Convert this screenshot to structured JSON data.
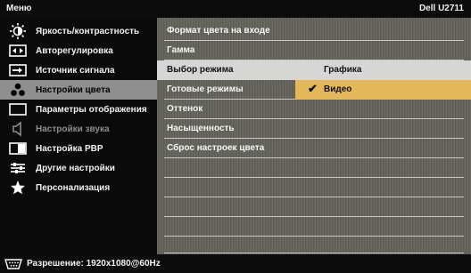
{
  "header": {
    "title": "Меню",
    "model": "Dell U2711"
  },
  "left_menu": [
    {
      "label": "Яркость/контрастность",
      "icon": "brightness-icon",
      "state": "normal"
    },
    {
      "label": "Авторегулировка",
      "icon": "auto-adjust-icon",
      "state": "normal"
    },
    {
      "label": "Источник сигнала",
      "icon": "input-source-icon",
      "state": "normal"
    },
    {
      "label": "Настройки цвета",
      "icon": "color-settings-icon",
      "state": "active"
    },
    {
      "label": "Параметры отображения",
      "icon": "display-settings-icon",
      "state": "normal"
    },
    {
      "label": "Настройки звука",
      "icon": "speaker-icon",
      "state": "disabled"
    },
    {
      "label": "Настройка PBP",
      "icon": "pbp-icon",
      "state": "normal"
    },
    {
      "label": "Другие настройки",
      "icon": "other-settings-icon",
      "state": "normal"
    },
    {
      "label": "Персонализация",
      "icon": "star-icon",
      "state": "normal"
    }
  ],
  "right_panel": {
    "rows": [
      {
        "label": "Формат цвета на входе"
      },
      {
        "label": "Гамма"
      },
      {
        "label": "Выбор режима",
        "value": "Графика"
      },
      {
        "label": "Готовые режимы",
        "highlighted_option": "Видео"
      },
      {
        "label": "Оттенок"
      },
      {
        "label": "Насыщенность"
      },
      {
        "label": "Сброс настроек цвета"
      }
    ],
    "empty_rows": 5
  },
  "footer": {
    "connector_icon": "vga-connector-icon",
    "resolution": "Разрешение: 1920x1080@60Hz"
  },
  "colors": {
    "highlight": "#e2b85b",
    "active_menu": "#8f8f8f",
    "selected_row": "#d6d6d4"
  }
}
